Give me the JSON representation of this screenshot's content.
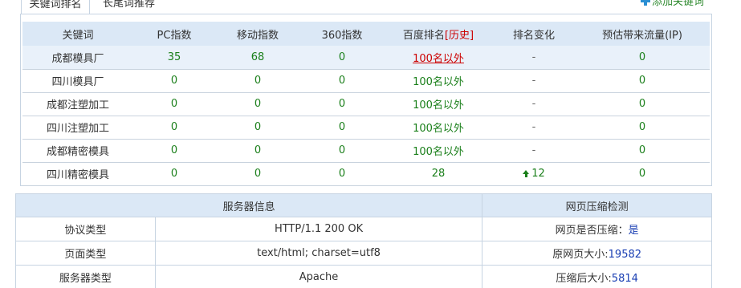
{
  "tabs": {
    "active_label": "关键词排名",
    "inactive_label": "长尾词推荐",
    "add_keyword_label": "添加关键词"
  },
  "keyword_table": {
    "headers": {
      "keyword": "关键词",
      "pc_index": "PC指数",
      "mobile_index": "移动指数",
      "index_360": "360指数",
      "baidu_rank": "百度排名",
      "history": "[历史]",
      "rank_change": "排名变化",
      "est_traffic": "预估带来流量(IP)"
    },
    "rows": [
      {
        "keyword": "成都模具厂",
        "pc": "35",
        "mobile": "68",
        "i360": "0",
        "rank": "100名以外",
        "change": "-",
        "traffic": "0"
      },
      {
        "keyword": "四川模具厂",
        "pc": "0",
        "mobile": "0",
        "i360": "0",
        "rank": "100名以外",
        "change": "-",
        "traffic": "0"
      },
      {
        "keyword": "成都注塑加工",
        "pc": "0",
        "mobile": "0",
        "i360": "0",
        "rank": "100名以外",
        "change": "-",
        "traffic": "0"
      },
      {
        "keyword": "四川注塑加工",
        "pc": "0",
        "mobile": "0",
        "i360": "0",
        "rank": "100名以外",
        "change": "-",
        "traffic": "0"
      },
      {
        "keyword": "成都精密模具",
        "pc": "0",
        "mobile": "0",
        "i360": "0",
        "rank": "100名以外",
        "change": "-",
        "traffic": "0"
      },
      {
        "keyword": "四川精密模具",
        "pc": "0",
        "mobile": "0",
        "i360": "0",
        "rank": "28",
        "change": "12",
        "traffic": "0"
      }
    ]
  },
  "server_table": {
    "header_server": "服务器信息",
    "header_compress": "网页压缩检测",
    "rows": [
      {
        "label": "协议类型",
        "value": "HTTP/1.1 200 OK",
        "c_label": "网页是否压缩：",
        "c_value": "是"
      },
      {
        "label": "页面类型",
        "value": "text/html; charset=utf8",
        "c_label": "原网页大小:",
        "c_value": "19582"
      },
      {
        "label": "服务器类型",
        "value": "Apache",
        "c_label": "压缩后大小:",
        "c_value": "5814"
      }
    ]
  },
  "colors": {
    "header_bg": "#dbe8f6",
    "border": "#c7d4e2",
    "green": "#1a7f1a",
    "red": "#cc0000",
    "blue": "#1a3fb3"
  }
}
